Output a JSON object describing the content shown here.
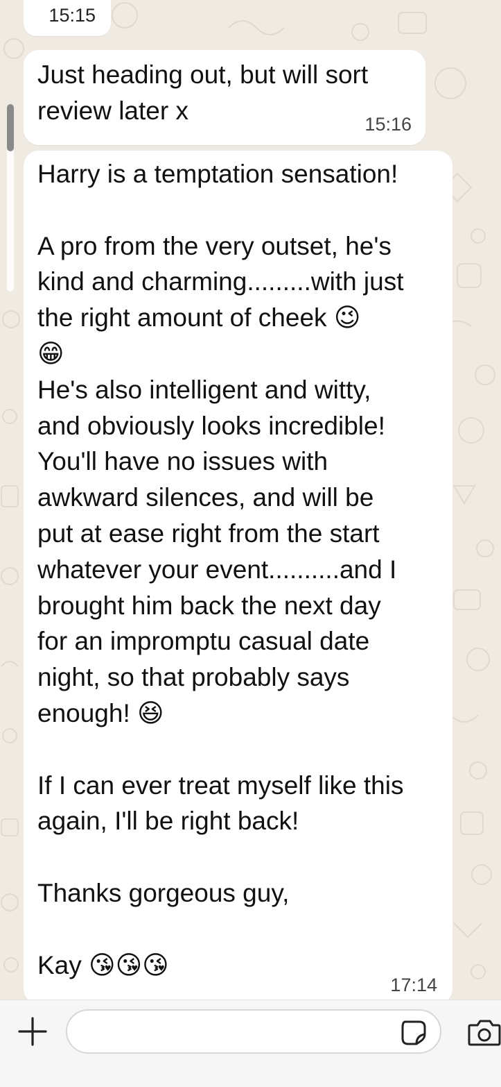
{
  "messages": [
    {
      "text": "",
      "time": "15:15"
    },
    {
      "text": "Just heading out, but will sort\nreview later x",
      "time": "15:16"
    },
    {
      "text": "Harry is a temptation sensation!\n\nA pro from the very outset, he's\nkind and charming.........with just\nthe right amount of cheek 😉\n😁\nHe's also intelligent and witty,\nand obviously looks incredible!\nYou'll have no issues with\nawkward silences, and will be\nput at ease right from the start\nwhatever your event..........and I\nbrought him back the next day\nfor an impromptu casual date\nnight, so that probably says\nenough! 😆\n\nIf I can ever treat myself like this\nagain, I'll be right back!\n\nThanks gorgeous guy,\n\nKay 😘😘😘",
      "time": "17:14"
    }
  ],
  "composer": {
    "placeholder": "",
    "plus_icon": "plus-icon",
    "sticker_icon": "sticker-icon",
    "camera_icon": "camera-icon"
  },
  "colors": {
    "background": "#efeae2",
    "bubble": "#ffffff",
    "composer": "#f6f6f6"
  }
}
